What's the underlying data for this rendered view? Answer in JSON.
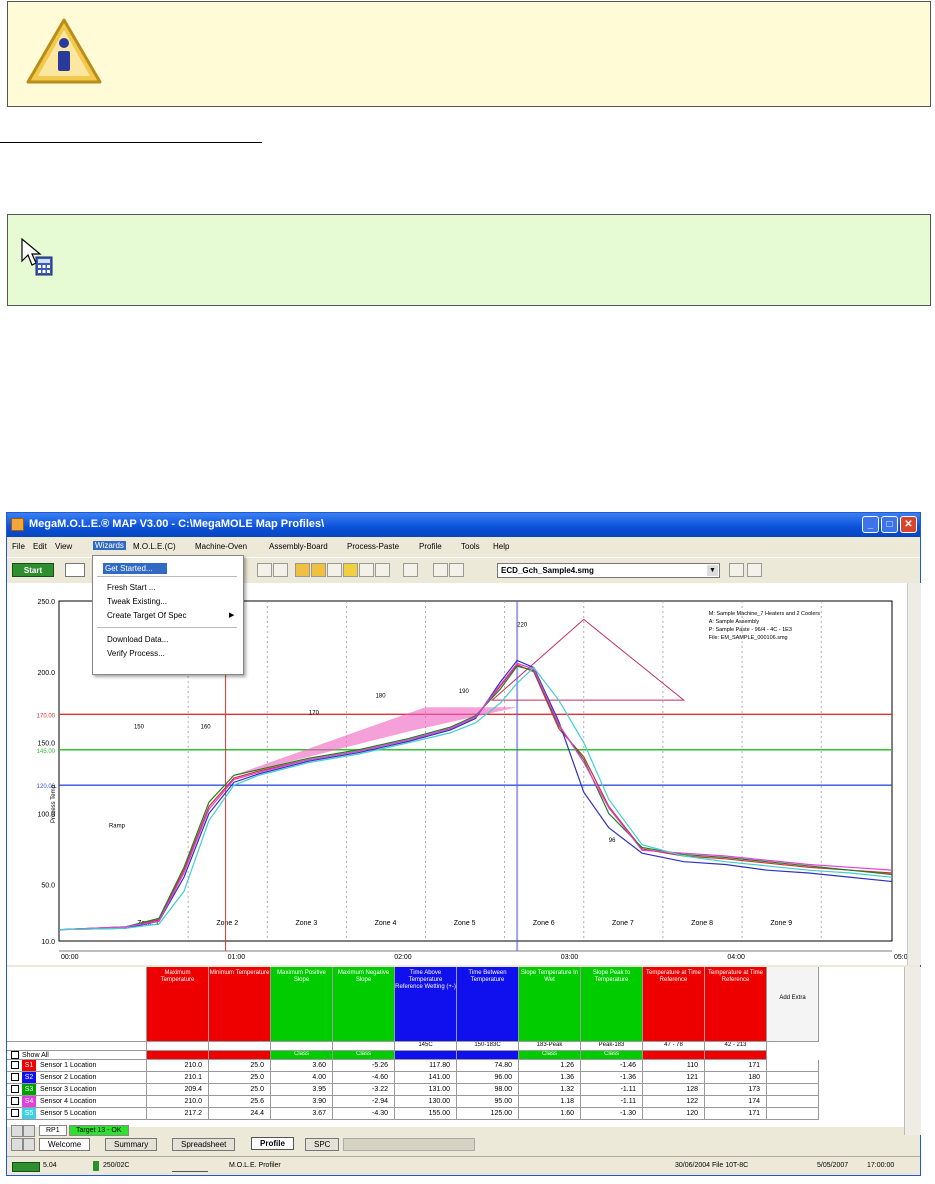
{
  "window": {
    "title": "MegaM.O.L.E.® MAP V3.00 - C:\\MegaMOLE Map Profiles\\",
    "menu": [
      "File",
      "Edit",
      "View",
      "Wizards",
      "M.O.L.E.(C)",
      "Machine-Oven",
      "Assembly-Board",
      "Process-Paste",
      "Profile",
      "Tools",
      "Help"
    ],
    "wizards_menu": [
      "Get Started...",
      "Fresh Start ...",
      "Tweak Existing...",
      "Create Target Of Spec",
      "Download Data...",
      "Verify Process..."
    ],
    "start_button": "Start",
    "profile_file": "ECD_Gch_Sample4.smg"
  },
  "chart_data": {
    "type": "line",
    "xlabel": "",
    "ylabel": "Process Temp",
    "ylim": [
      10,
      250
    ],
    "yticks": [
      "250.0",
      "200.0",
      "150.0",
      "100.0",
      "50.0",
      "10.0"
    ],
    "ref_lines": [
      {
        "label": "170.00",
        "value": 170,
        "color": "#e03030"
      },
      {
        "label": "145.00",
        "value": 145,
        "color": "#30c030"
      },
      {
        "label": "120.00",
        "value": 120,
        "color": "#3050e0"
      }
    ],
    "zones": [
      "Zone 1",
      "Zone 2",
      "Zone 3",
      "Zone 4",
      "Zone 5",
      "Zone 6",
      "Zone 7",
      "Zone 8",
      "Zone 9"
    ],
    "time_labels": [
      "00:00",
      "01:00",
      "02:00",
      "03:00",
      "04:00",
      "05:00"
    ],
    "annotations": [
      "Ramp",
      "150",
      "160",
      "170",
      "180",
      "190",
      "220",
      "96"
    ],
    "info_box": [
      "M: Sample Machine_7 Heaters and 2 Coolers",
      "A: Sample Assembly",
      "P: Sample Paste - 96/4 - 4C - 1E3",
      "File: EM_SAMPLE_000106.smg"
    ],
    "series": [
      {
        "name": "Sensor 1 Location",
        "color": "#d03030",
        "x": [
          0,
          8,
          12,
          15,
          18,
          21,
          24,
          30,
          36,
          42,
          47,
          50,
          53,
          55,
          57,
          60,
          63,
          66,
          70,
          75,
          80,
          85,
          90,
          95,
          100
        ],
        "y": [
          18,
          20,
          25,
          60,
          105,
          125,
          130,
          138,
          144,
          152,
          160,
          168,
          190,
          205,
          200,
          160,
          140,
          105,
          75,
          70,
          68,
          65,
          62,
          60,
          58
        ]
      },
      {
        "name": "Sensor 2 Location",
        "color": "#3030c0",
        "x": [
          0,
          8,
          12,
          15,
          18,
          21,
          24,
          30,
          36,
          42,
          47,
          50,
          53,
          55,
          57,
          60,
          63,
          66,
          70,
          75,
          80,
          85,
          90,
          95,
          100
        ],
        "y": [
          18,
          19,
          24,
          55,
          100,
          122,
          128,
          137,
          143,
          151,
          159,
          167,
          193,
          208,
          203,
          165,
          115,
          90,
          72,
          66,
          64,
          60,
          58,
          55,
          52
        ]
      },
      {
        "name": "Sensor 3 Location",
        "color": "#208020",
        "x": [
          0,
          8,
          12,
          15,
          18,
          21,
          24,
          30,
          36,
          42,
          47,
          50,
          53,
          55,
          57,
          60,
          63,
          66,
          70,
          75,
          80,
          85,
          90,
          95,
          100
        ],
        "y": [
          18,
          20,
          26,
          62,
          108,
          127,
          131,
          139,
          145,
          153,
          161,
          169,
          188,
          204,
          201,
          162,
          138,
          100,
          76,
          71,
          69,
          66,
          63,
          60,
          57
        ]
      },
      {
        "name": "Sensor 4 Location",
        "color": "#e040e0",
        "x": [
          0,
          8,
          12,
          15,
          18,
          21,
          24,
          30,
          36,
          42,
          47,
          50,
          53,
          55,
          57,
          60,
          63,
          66,
          70,
          75,
          80,
          85,
          90,
          95,
          100
        ],
        "y": [
          18,
          20,
          24,
          58,
          103,
          124,
          129,
          138,
          144,
          152,
          160,
          168,
          191,
          206,
          202,
          163,
          136,
          104,
          74,
          72,
          70,
          67,
          64,
          62,
          60
        ]
      },
      {
        "name": "Sensor 5 Location",
        "color": "#40d0d0",
        "x": [
          0,
          8,
          12,
          15,
          18,
          21,
          24,
          30,
          36,
          42,
          47,
          50,
          53,
          55,
          57,
          60,
          63,
          66,
          70,
          75,
          80,
          85,
          90,
          95,
          100
        ],
        "y": [
          18,
          19,
          22,
          45,
          95,
          120,
          127,
          136,
          142,
          150,
          157,
          164,
          178,
          192,
          203,
          180,
          150,
          110,
          78,
          70,
          66,
          63,
          60,
          58,
          55
        ]
      }
    ]
  },
  "table": {
    "columns": [
      {
        "label": "Maximum Temperature",
        "color": "#ee0000"
      },
      {
        "label": "Minimum Temperature",
        "color": "#ee0000"
      },
      {
        "label": "Maximum Positive Slope",
        "color": "#00cc00"
      },
      {
        "label": "Maximum Negative Slope",
        "color": "#00cc00"
      },
      {
        "label": "Time Above Temperature Reference Wetting (+-)",
        "color": "#1010ee"
      },
      {
        "label": "Time Between Temperature",
        "color": "#1010ee"
      },
      {
        "label": "Slope Temperature In Wet",
        "color": "#00cc00"
      },
      {
        "label": "Slope Peak to Temperature",
        "color": "#00cc00"
      },
      {
        "label": "Temperature at Time Reference",
        "color": "#ee0000"
      },
      {
        "label": "Temperature at Time Reference",
        "color": "#ee0000"
      }
    ],
    "add_extra": "Add Extra",
    "spec_row": [
      "",
      "",
      "",
      "",
      "145C",
      "150-183C",
      "183-Peak",
      "Peak-183",
      "47 - 78",
      "42 - 213"
    ],
    "show_all": "Show All",
    "status_row": [
      "",
      "",
      "Class",
      "Class",
      "",
      "",
      "Class",
      "Class",
      "",
      ""
    ],
    "rows": [
      {
        "badge": "S1",
        "color": "#ee0000",
        "name": "Sensor 1 Location",
        "values": [
          "210.0",
          "25.0",
          "3.60",
          "-5.26",
          "117.80",
          "74.80",
          "1.26",
          "-1.46",
          "110",
          "171"
        ]
      },
      {
        "badge": "S2",
        "color": "#1010ee",
        "name": "Sensor 2 Location",
        "values": [
          "210.1",
          "25.0",
          "4.00",
          "-4.60",
          "141.00",
          "96.00",
          "1.36",
          "-1.36",
          "121",
          "180"
        ]
      },
      {
        "badge": "S3",
        "color": "#00a000",
        "name": "Sensor 3 Location",
        "values": [
          "209.4",
          "25.0",
          "3.95",
          "-3.22",
          "131.00",
          "98.00",
          "1.32",
          "-1.11",
          "128",
          "173"
        ]
      },
      {
        "badge": "S4",
        "color": "#e040e0",
        "name": "Sensor 4 Location",
        "values": [
          "210.0",
          "25.6",
          "3.90",
          "-2.94",
          "130.00",
          "95.00",
          "1.18",
          "-1.11",
          "122",
          "174"
        ]
      },
      {
        "badge": "S5",
        "color": "#40d0e0",
        "name": "Sensor 5 Location",
        "values": [
          "217.2",
          "24.4",
          "3.67",
          "-4.30",
          "155.00",
          "125.00",
          "1.60",
          "-1.30",
          "120",
          "171"
        ]
      }
    ],
    "sheet_tabs": [
      "RP1",
      "Target 13 - OK"
    ]
  },
  "bottom_tabs": [
    "Welcome",
    "Summary",
    "Spreadsheet",
    "Profile",
    "SPC"
  ],
  "status": {
    "left1": "5.04",
    "left2": "250/02C",
    "left3": "M.O.L.E. Profiler",
    "right1": "30/06/2004 File 10T-8C",
    "right2": "5/05/2007",
    "right3": "17:00:00"
  }
}
